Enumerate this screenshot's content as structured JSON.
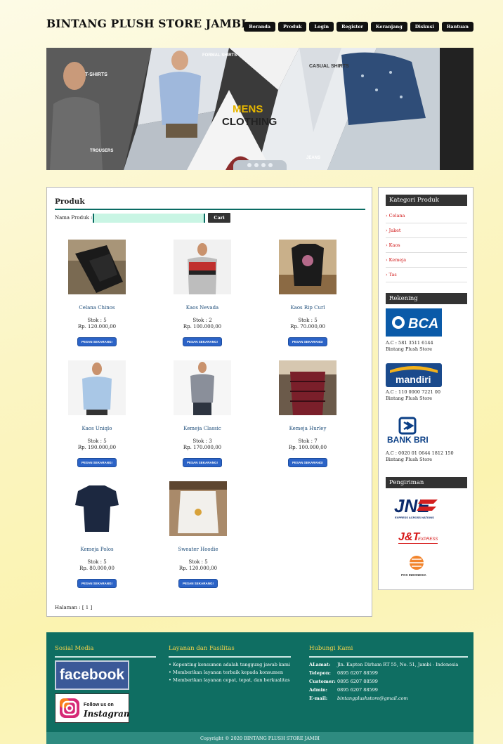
{
  "site": {
    "title": "BINTANG PLUSH STORE JAMBI"
  },
  "nav": [
    "Beranda",
    "Produk",
    "Login",
    "Register",
    "Keranjang",
    "Diskusi",
    "Bantuan"
  ],
  "banner": {
    "labels": [
      "T-SHIRTS",
      "FORMAL SHIRTS",
      "CASUAL SHIRTS",
      "MENS",
      "CLOTHING",
      "TROUSERS",
      "JEANS"
    ]
  },
  "main": {
    "title": "Produk",
    "search_label": "Nama Produk :",
    "search_value": "",
    "search_button": "Cari",
    "products": [
      {
        "name": "Celana Chinos",
        "stok": "Stok : 5",
        "price": "Rp. 120.000,00",
        "button": "PESAN SEKARANG!"
      },
      {
        "name": "Kaos Nevada",
        "stok": "Stok : 2",
        "price": "Rp. 100.000,00",
        "button": "PESAN SEKARANG!"
      },
      {
        "name": "Kaos Rip Curl",
        "stok": "Stok : 5",
        "price": "Rp. 70.000,00",
        "button": "PESAN SEKARANG!"
      },
      {
        "name": "Kaos Uniqlo",
        "stok": "Stok : 5",
        "price": "Rp. 190.000,00",
        "button": "PESAN SEKARANG!"
      },
      {
        "name": "Kemeja Classic",
        "stok": "Stok : 3",
        "price": "Rp. 170.000,00",
        "button": "PESAN SEKARANG!"
      },
      {
        "name": "Kemeja Hurley",
        "stok": "Stok : 7",
        "price": "Rp. 100.000,00",
        "button": "PESAN SEKARANG!"
      },
      {
        "name": "Kemeja Polos",
        "stok": "Stok : 5",
        "price": "Rp. 80.000,00",
        "button": "PESAN SEKARANG!"
      },
      {
        "name": "Sweater Hoodie",
        "stok": "Stok : 5",
        "price": "Rp. 120.000,00",
        "button": "PESAN SEKARANG!"
      }
    ],
    "pagination": "Halaman : [ 1 ]"
  },
  "sidebar": {
    "category_title": "Kategori Produk",
    "categories": [
      "› Celana",
      "› Jaket",
      "› Kaos",
      "› Kemeja",
      "› Tas"
    ],
    "rekening_title": "Rekening",
    "banks": [
      {
        "logo": "BCA",
        "account": "A.C : 581 3511 6144",
        "owner": "Bintang Plush Store"
      },
      {
        "logo": "mandiri",
        "account": "A.C : 110 0000 7221 00",
        "owner": "Bintang Plush Store"
      },
      {
        "logo": "BANK BRI",
        "account": "A.C : 0020 01 0644 1812 150",
        "owner": "Bintang Plush Store"
      }
    ],
    "shipping_title": "Pengiriman",
    "couriers": [
      {
        "logo": "JNE",
        "tagline": "EXPRESS ACROSS NATIONS"
      },
      {
        "logo": "J&T",
        "tagline": "EXPRESS"
      },
      {
        "logo": "POS INDONESIA",
        "tagline": ""
      }
    ]
  },
  "footer": {
    "social_title": "Sosial Media",
    "facebook": "facebook",
    "instagram_line1": "Follow us on",
    "instagram_line2": "Instagram",
    "services_title": "Layanan dan Fasilitas",
    "services": [
      "Kepenting konsumen adalah tanggung jawab kami",
      "Memberikan layanan terbaik kepada konsumen",
      "Memberikan layanan cepat, tepat, dan berkualitas"
    ],
    "contact_title": "Hubungi Kami",
    "contact": [
      {
        "label": "ALamat:",
        "value": "Jln. Kapten Dirham RT 55, No. 51, Jambi - Indonesia"
      },
      {
        "label": "Telepon:",
        "value": "0895 6207 88599"
      },
      {
        "label": "Customer:",
        "value": "0895 6207 88599"
      },
      {
        "label": "Admin:",
        "value": "0895 6207 88599"
      },
      {
        "label": "E-mail:",
        "value": "bintangplushstore@gmail.com"
      }
    ],
    "copyright": "Copyright © 2020 BINTANG PLUSH STORE JAMBI"
  },
  "colors": {
    "accent": "#0a6b63",
    "footer": "#0f6e62",
    "footer_heading": "#f5d44a",
    "nav": "#111111",
    "link": "#d01515",
    "button": "#2b63c7"
  }
}
